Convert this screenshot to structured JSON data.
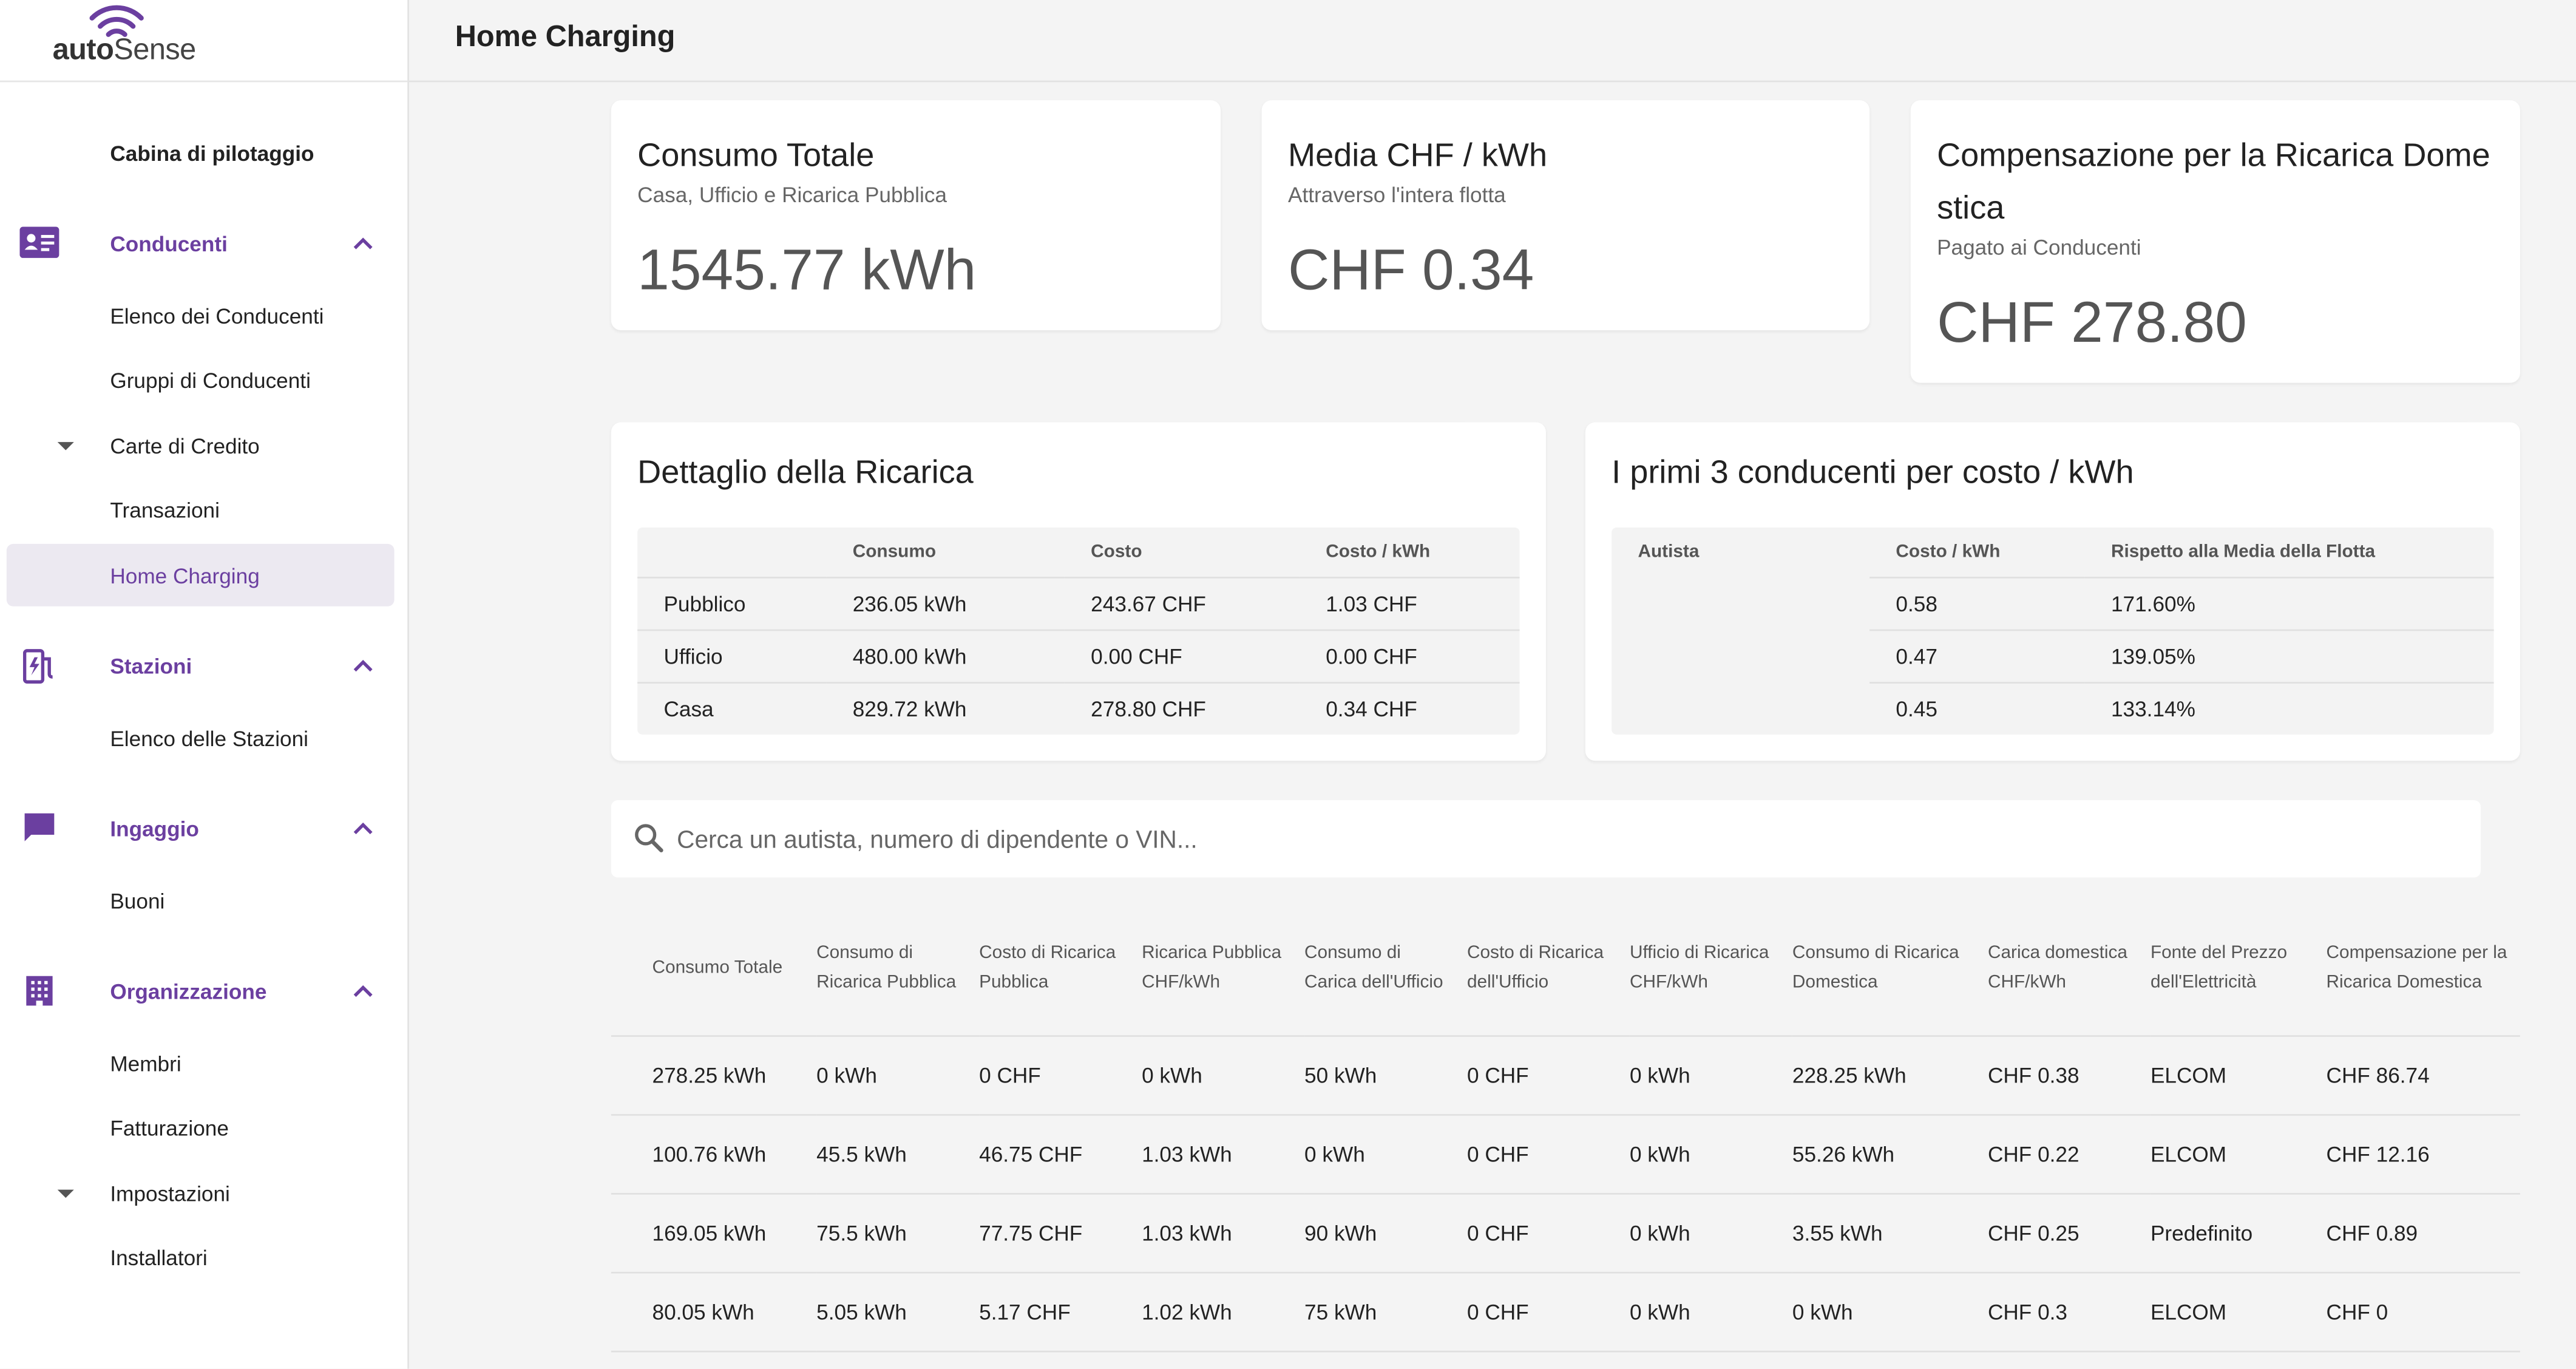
{
  "brand": {
    "name_bold": "auto",
    "name_rest": "Sense"
  },
  "page_title": "Home Charging",
  "sidebar": {
    "items": [
      {
        "label": "Cabina di pilotaggio",
        "kind": "bold"
      },
      {
        "label": "Conducenti",
        "kind": "section",
        "icon": "id-card-icon",
        "expanded": true
      },
      {
        "label": "Elenco dei Conducenti",
        "kind": "sub"
      },
      {
        "label": "Gruppi di Conducenti",
        "kind": "sub"
      },
      {
        "label": "Carte di Credito",
        "kind": "sub",
        "caret": true
      },
      {
        "label": "Transazioni",
        "kind": "sub"
      },
      {
        "label": "Home Charging",
        "kind": "sub",
        "active": true
      },
      {
        "label": "Stazioni",
        "kind": "section",
        "icon": "ev-station-icon",
        "expanded": true
      },
      {
        "label": "Elenco delle Stazioni",
        "kind": "sub"
      },
      {
        "label": "Ingaggio",
        "kind": "section",
        "icon": "chat-icon",
        "expanded": true
      },
      {
        "label": "Buoni",
        "kind": "sub"
      },
      {
        "label": "Organizzazione",
        "kind": "section",
        "icon": "building-icon",
        "expanded": true
      },
      {
        "label": "Membri",
        "kind": "sub"
      },
      {
        "label": "Fatturazione",
        "kind": "sub"
      },
      {
        "label": "Impostazioni",
        "kind": "sub",
        "caret": true
      },
      {
        "label": "Installatori",
        "kind": "sub"
      }
    ]
  },
  "kpis": [
    {
      "title": "Consumo Totale",
      "subtitle": "Casa, Ufficio e Ricarica Pubblica",
      "value": "1545.77 kWh"
    },
    {
      "title": "Media CHF / kWh",
      "subtitle": "Attraverso l'intera flotta",
      "value": "CHF 0.34"
    },
    {
      "title": "Compensazione per la Ricarica Domestica",
      "subtitle": "Pagato ai Conducenti",
      "value": "CHF 278.80"
    }
  ],
  "charging_detail": {
    "title": "Dettaglio della Ricarica",
    "headers": [
      "",
      "Consumo",
      "Costo",
      "Costo / kWh"
    ],
    "rows": [
      [
        "Pubblico",
        "236.05 kWh",
        "243.67 CHF",
        "1.03 CHF"
      ],
      [
        "Ufficio",
        "480.00 kWh",
        "0.00 CHF",
        "0.00 CHF"
      ],
      [
        "Casa",
        "829.72 kWh",
        "278.80 CHF",
        "0.34 CHF"
      ]
    ]
  },
  "top_drivers": {
    "title": "I primi 3 conducenti per costo / kWh",
    "headers": [
      "Autista",
      "Costo / kWh",
      "Rispetto alla Media della Flotta"
    ],
    "rows": [
      [
        "",
        "0.58",
        "171.60%"
      ],
      [
        "",
        "0.47",
        "139.05%"
      ],
      [
        "",
        "0.45",
        "133.14%"
      ]
    ]
  },
  "search": {
    "placeholder": "Cerca un autista, numero di dipendente o VIN..."
  },
  "table": {
    "headers": [
      "Consumo Totale",
      "Consumo di Ricarica Pubblica",
      "Costo di Ricarica Pubblica",
      "Ricarica Pubblica CHF/kWh",
      "Consumo di Carica dell'Ufficio",
      "Costo di Ricarica dell'Ufficio",
      "Ufficio di Ricarica CHF/kWh",
      "Consumo di Ricarica Domestica",
      "Carica domestica CHF/kWh",
      "Fonte del Prezzo dell'Elettricità",
      "Compensazione per la Ricarica Domestica"
    ],
    "rows": [
      [
        "278.25 kWh",
        "0 kWh",
        "0 CHF",
        "0 kWh",
        "50 kWh",
        "0 CHF",
        "0 kWh",
        "228.25 kWh",
        "CHF 0.38",
        "ELCOM",
        "CHF 86.74"
      ],
      [
        "100.76 kWh",
        "45.5 kWh",
        "46.75 CHF",
        "1.03 kWh",
        "0 kWh",
        "0 CHF",
        "0 kWh",
        "55.26 kWh",
        "CHF 0.22",
        "ELCOM",
        "CHF 12.16"
      ],
      [
        "169.05 kWh",
        "75.5 kWh",
        "77.75 CHF",
        "1.03 kWh",
        "90 kWh",
        "0 CHF",
        "0 kWh",
        "3.55 kWh",
        "CHF 0.25",
        "Predefinito",
        "CHF 0.89"
      ],
      [
        "80.05 kWh",
        "5.05 kWh",
        "5.17 CHF",
        "1.02 kWh",
        "75 kWh",
        "0 CHF",
        "0 kWh",
        "0 kWh",
        "CHF 0.3",
        "ELCOM",
        "CHF 0"
      ]
    ]
  },
  "colors": {
    "accent": "#6b3fa0",
    "active_bg": "#ece9f1",
    "page_bg": "#f4f4f4"
  }
}
